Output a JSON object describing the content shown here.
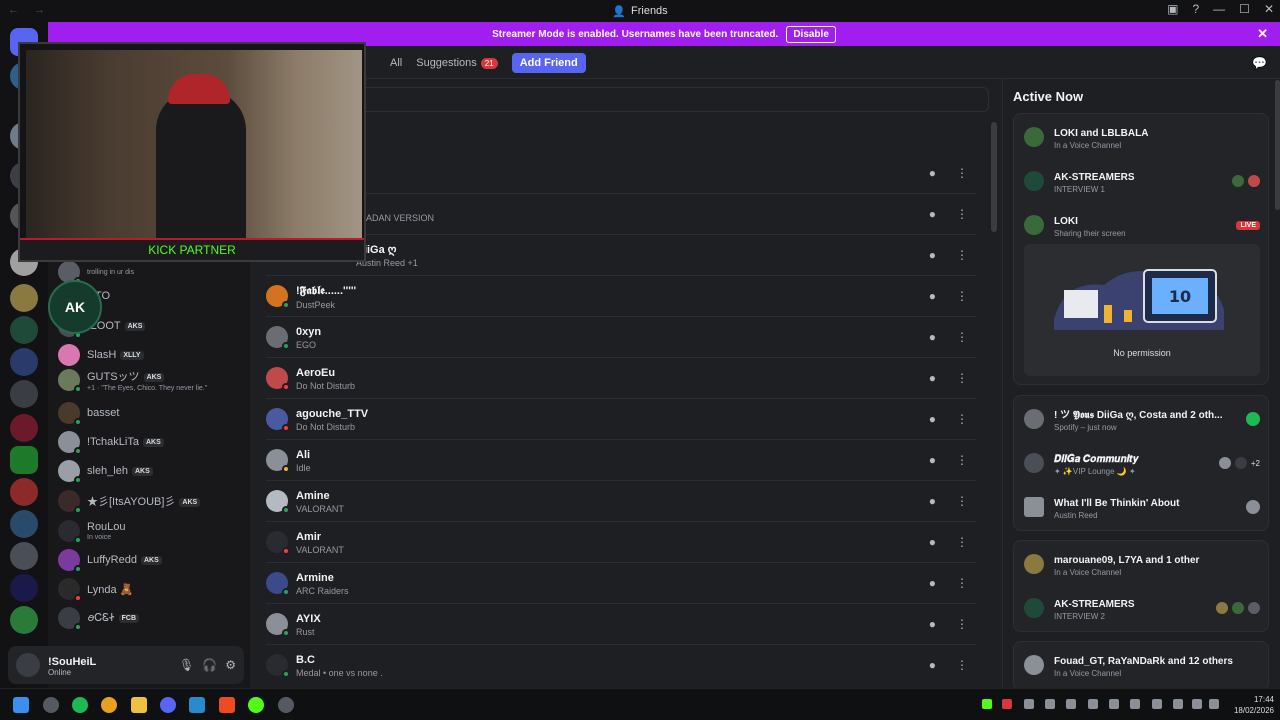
{
  "window": {
    "title": "Friends"
  },
  "banner": {
    "text": "Streamer Mode is enabled. Usernames have been truncated.",
    "button": "Disable"
  },
  "tabs": [
    {
      "label": "All"
    },
    {
      "label": "Suggestions",
      "badge": "21"
    },
    {
      "label": "Add Friend"
    }
  ],
  "overlay": {
    "webcam_caption": "KICK PARTNER",
    "logo_text": "AK"
  },
  "sidebar": {
    "dms": [
      {
        "name": "CTO",
        "sub": "",
        "tag": ""
      },
      {
        "name": "rLOOT",
        "sub": "",
        "tag": "AKS"
      },
      {
        "name": "SlasH",
        "sub": "",
        "tag": "XLLY"
      },
      {
        "name": "GUTSッツ",
        "sub": "+1 · \"The Eyes, Chico. They never lie.\"",
        "tag": "AKS"
      },
      {
        "name": "basset",
        "sub": "",
        "tag": ""
      },
      {
        "name": "!TchakLiTa",
        "sub": "",
        "tag": "AKS"
      },
      {
        "name": "sleh_leh",
        "sub": "",
        "tag": "AKS"
      },
      {
        "name": "★彡[ItsAYOUB]彡",
        "sub": "",
        "tag": "AKS"
      },
      {
        "name": "RouLou",
        "sub": "In voice",
        "tag": ""
      },
      {
        "name": "LuffyRedd",
        "sub": "",
        "tag": "AKS"
      },
      {
        "name": "Lynda 🧸",
        "sub": "",
        "tag": ""
      },
      {
        "name": "ꪮᏟᏋᏐ",
        "sub": "",
        "tag": "FCB"
      }
    ],
    "partial_top": {
      "name": "trolling in ur dis"
    }
  },
  "user": {
    "name": "!SouHeiL",
    "status": "Online"
  },
  "friends": [
    {
      "name": "",
      "status": ""
    },
    {
      "name": "",
      "status": "ADAN VERSION"
    },
    {
      "name": "DiiGa ღ",
      "status": "Austin Reed +1"
    },
    {
      "name": "!𝕱𝖆𝖇𝖑𝖊......'''''",
      "status": "DustPeek"
    },
    {
      "name": "0xyn",
      "status": "EGO"
    },
    {
      "name": "AeroEu",
      "status": "Do Not Disturb"
    },
    {
      "name": "agouche_TTV",
      "status": "Do Not Disturb"
    },
    {
      "name": "Ali",
      "status": "Idle"
    },
    {
      "name": "Amine",
      "status": "VALORANT"
    },
    {
      "name": "Amir",
      "status": "VALORANT"
    },
    {
      "name": "Armine",
      "status": "ARC Raiders"
    },
    {
      "name": "AYIX",
      "status": "Rust"
    },
    {
      "name": "B.C",
      "status": "Medal • one vs none ."
    }
  ],
  "active_now": {
    "title": "Active Now",
    "cards": [
      {
        "rows": [
          {
            "title": "LOKI and LBLBALA",
            "sub": "In a Voice Channel"
          },
          {
            "title": "AK-STREAMERS",
            "sub": "INTERVIEW 1"
          },
          {
            "title": "LOKI",
            "sub": "Sharing their screen",
            "badge": "LIVE"
          }
        ],
        "preview_text": "No permission"
      },
      {
        "rows": [
          {
            "title": "! ツ 𝖄𝖔𝖚𝖘 DiiGa ღ, Costa and 2 oth...",
            "sub": "Spotify – just now"
          },
          {
            "title": "𝑫𝒊𝒊𝑮𝒂 𝑪𝒐𝒎𝒎𝒖𝒏𝒊𝒕𝒚",
            "sub": "✦ ✨VIP Lounge 🌙 ✦",
            "extra": "+2"
          },
          {
            "title": "What I'll Be Thinkin' About",
            "sub": "Austin Reed"
          }
        ]
      },
      {
        "rows": [
          {
            "title": "marouane09, L7YA and 1 other",
            "sub": "In a Voice Channel"
          },
          {
            "title": "AK-STREAMERS",
            "sub": "INTERVIEW 2"
          }
        ]
      },
      {
        "rows": [
          {
            "title": "Fouad_GT, RaYaNDaRk and 12 others",
            "sub": "In a Voice Channel"
          }
        ]
      }
    ]
  },
  "taskbar": {
    "time": "17:44",
    "date": "18/02/2026"
  },
  "colors": {
    "accent": "#5865f2",
    "streamer_banner": "#a11ef0",
    "online": "#23a55a",
    "dnd": "#f23f43",
    "idle": "#f0b232"
  }
}
